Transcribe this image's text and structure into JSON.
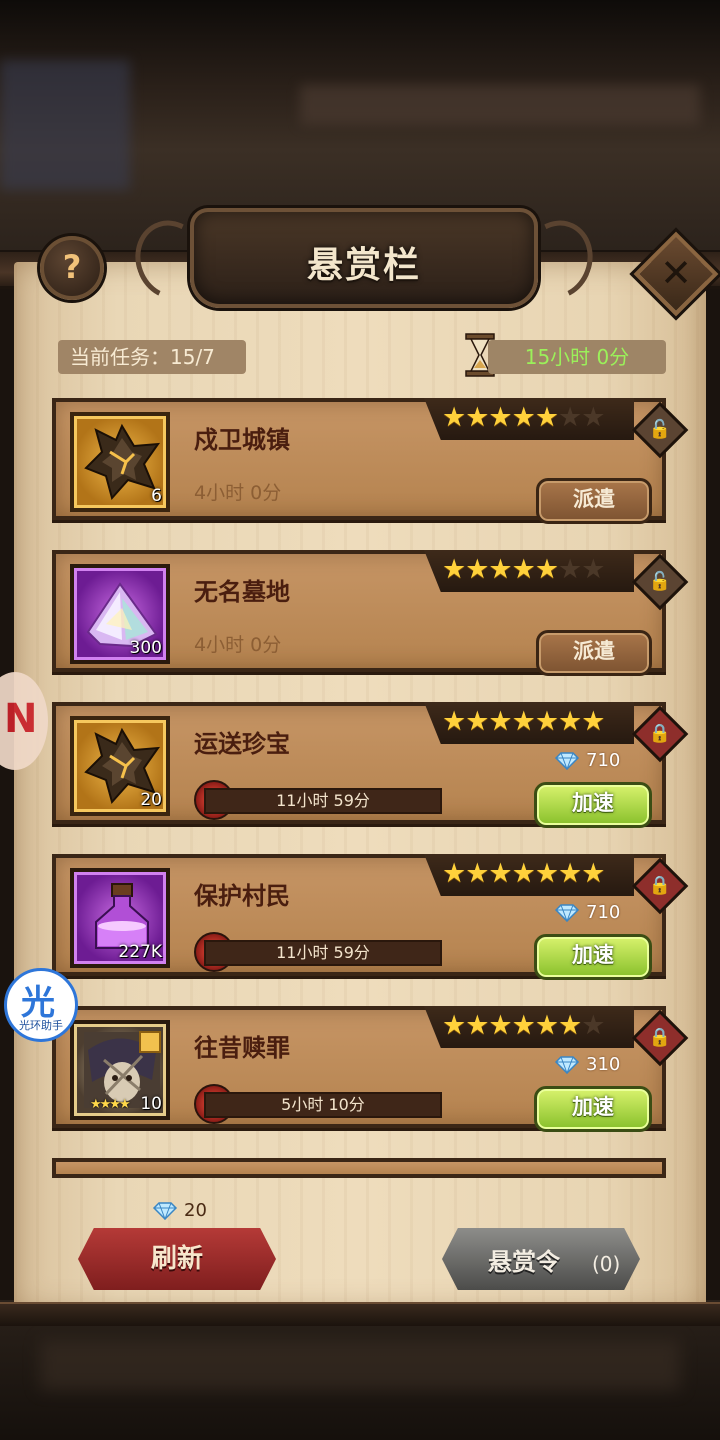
{
  "header": {
    "title": "悬赏栏",
    "help_glyph": "?",
    "close_glyph": "✕"
  },
  "status": {
    "current_tasks": "当前任务：15/7",
    "timer": "15小时 0分"
  },
  "bounties": [
    {
      "name": "戍卫城镇",
      "qty": "6",
      "icon": "gold-ore-icon",
      "frame": "gold",
      "stars_on": 5,
      "stars_total": 7,
      "duration": "4小时 0分",
      "action": "派遣",
      "lock": "open"
    },
    {
      "name": "无名墓地",
      "qty": "300",
      "icon": "crystal-shard-icon",
      "frame": "purple",
      "stars_on": 5,
      "stars_total": 7,
      "duration": "4小时 0分",
      "action": "派遣",
      "lock": "open"
    },
    {
      "name": "运送珍宝",
      "qty": "20",
      "icon": "gold-ore-icon",
      "frame": "gold",
      "stars_on": 7,
      "stars_total": 7,
      "timer": "11小时 59分",
      "cost": "710",
      "action": "加速",
      "lock": "closed"
    },
    {
      "name": "保护村民",
      "qty": "227K",
      "icon": "potion-bottle-icon",
      "frame": "purple",
      "stars_on": 7,
      "stars_total": 7,
      "timer": "11小时 59分",
      "cost": "710",
      "action": "加速",
      "lock": "closed"
    },
    {
      "name": "往昔赎罪",
      "qty": "10",
      "icon": "hero-fragment-icon",
      "frame": "dark",
      "stars_on": 6,
      "stars_total": 7,
      "hero_stars": "★★★★",
      "timer": "5小时 10分",
      "cost": "310",
      "action": "加速",
      "lock": "closed"
    }
  ],
  "footer": {
    "refresh_cost": "20",
    "refresh_label": "刷新",
    "bounty_order_label": "悬赏令",
    "bounty_order_count": "(0)"
  },
  "overlay": {
    "assistant_glyph": "光",
    "assistant_caption": "光环助手",
    "red_widget_glyph": "N"
  },
  "colors": {
    "timer_green": "#9bf05a",
    "speed_button": "#a8d83f",
    "refresh_button": "#a3302f"
  }
}
